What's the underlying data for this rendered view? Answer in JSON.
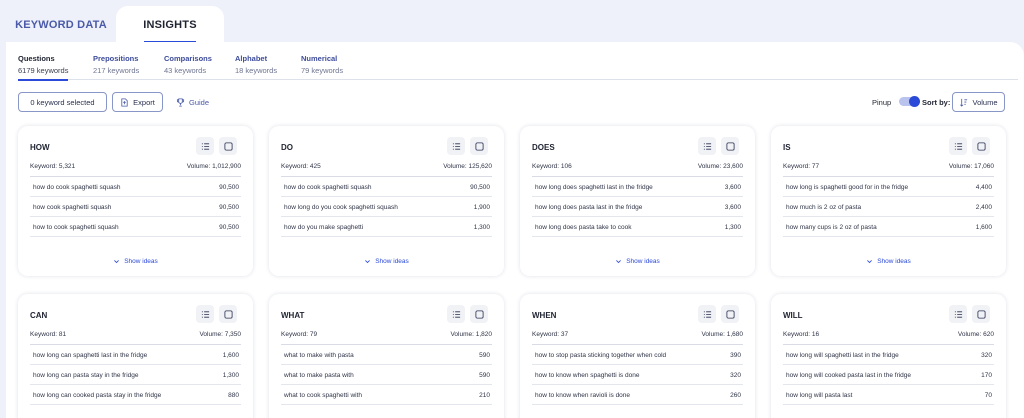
{
  "main_tabs": [
    "KEYWORD DATA",
    "INSIGHTS"
  ],
  "sub_tabs": [
    {
      "title": "Questions",
      "count": "6179 keywords"
    },
    {
      "title": "Prepositions",
      "count": "217 keywords"
    },
    {
      "title": "Comparisons",
      "count": "43 keywords"
    },
    {
      "title": "Alphabet",
      "count": "18 keywords"
    },
    {
      "title": "Numerical",
      "count": "79 keywords"
    }
  ],
  "toolbar": {
    "selected_label": "0 keyword selected",
    "export_label": "Export",
    "guide_label": "Guide",
    "pinup_label": "Pinup",
    "sort_label": "Sort by:",
    "sort_value": "Volume"
  },
  "show_ideas_label": "Show ideas",
  "cards": [
    {
      "title": "HOW",
      "keyword": "Keyword: 5,321",
      "volume": "Volume: 1,012,900",
      "rows": [
        [
          "how do cook spaghetti squash",
          "90,500"
        ],
        [
          "how cook spaghetti squash",
          "90,500"
        ],
        [
          "how to cook spaghetti squash",
          "90,500"
        ]
      ]
    },
    {
      "title": "DO",
      "keyword": "Keyword: 425",
      "volume": "Volume: 125,620",
      "rows": [
        [
          "how do cook spaghetti squash",
          "90,500"
        ],
        [
          "how long do you cook spaghetti squash",
          "1,900"
        ],
        [
          "how do you make spaghetti",
          "1,300"
        ]
      ]
    },
    {
      "title": "DOES",
      "keyword": "Keyword: 106",
      "volume": "Volume: 23,600",
      "rows": [
        [
          "how long does spaghetti last in the fridge",
          "3,600"
        ],
        [
          "how long does pasta last in the fridge",
          "3,600"
        ],
        [
          "how long does pasta take to cook",
          "1,300"
        ]
      ]
    },
    {
      "title": "IS",
      "keyword": "Keyword: 77",
      "volume": "Volume: 17,060",
      "rows": [
        [
          "how long is spaghetti good for in the fridge",
          "4,400"
        ],
        [
          "how much is 2 oz of pasta",
          "2,400"
        ],
        [
          "how many cups is 2 oz of pasta",
          "1,600"
        ]
      ]
    },
    {
      "title": "CAN",
      "keyword": "Keyword: 81",
      "volume": "Volume: 7,350",
      "rows": [
        [
          "how long can spaghetti last in the fridge",
          "1,600"
        ],
        [
          "how long can pasta stay in the fridge",
          "1,300"
        ],
        [
          "how long can cooked pasta stay in the fridge",
          "880"
        ]
      ]
    },
    {
      "title": "WHAT",
      "keyword": "Keyword: 79",
      "volume": "Volume: 1,820",
      "rows": [
        [
          "what to make with pasta",
          "590"
        ],
        [
          "what to make pasta with",
          "590"
        ],
        [
          "what to cook spaghetti with",
          "210"
        ]
      ]
    },
    {
      "title": "WHEN",
      "keyword": "Keyword: 37",
      "volume": "Volume: 1,680",
      "rows": [
        [
          "how to stop pasta sticking together when cold",
          "390"
        ],
        [
          "how to know when spaghetti is done",
          "320"
        ],
        [
          "how to know when ravioli is done",
          "260"
        ]
      ]
    },
    {
      "title": "WILL",
      "keyword": "Keyword: 16",
      "volume": "Volume: 620",
      "rows": [
        [
          "how long will spaghetti last in the fridge",
          "320"
        ],
        [
          "how long will cooked pasta last in the fridge",
          "170"
        ],
        [
          "how long will pasta last",
          "70"
        ]
      ]
    }
  ],
  "colors": {
    "accent": "#2c4ad8",
    "tab_text": "#4a5aa8",
    "background": "#eef1fa"
  },
  "icons": {
    "export": "export-icon",
    "guide": "trophy-icon",
    "sort": "sort-icon",
    "card_list": "list-icon",
    "card_check": "checkbox-icon",
    "ideas": "chevron-down-icon"
  }
}
